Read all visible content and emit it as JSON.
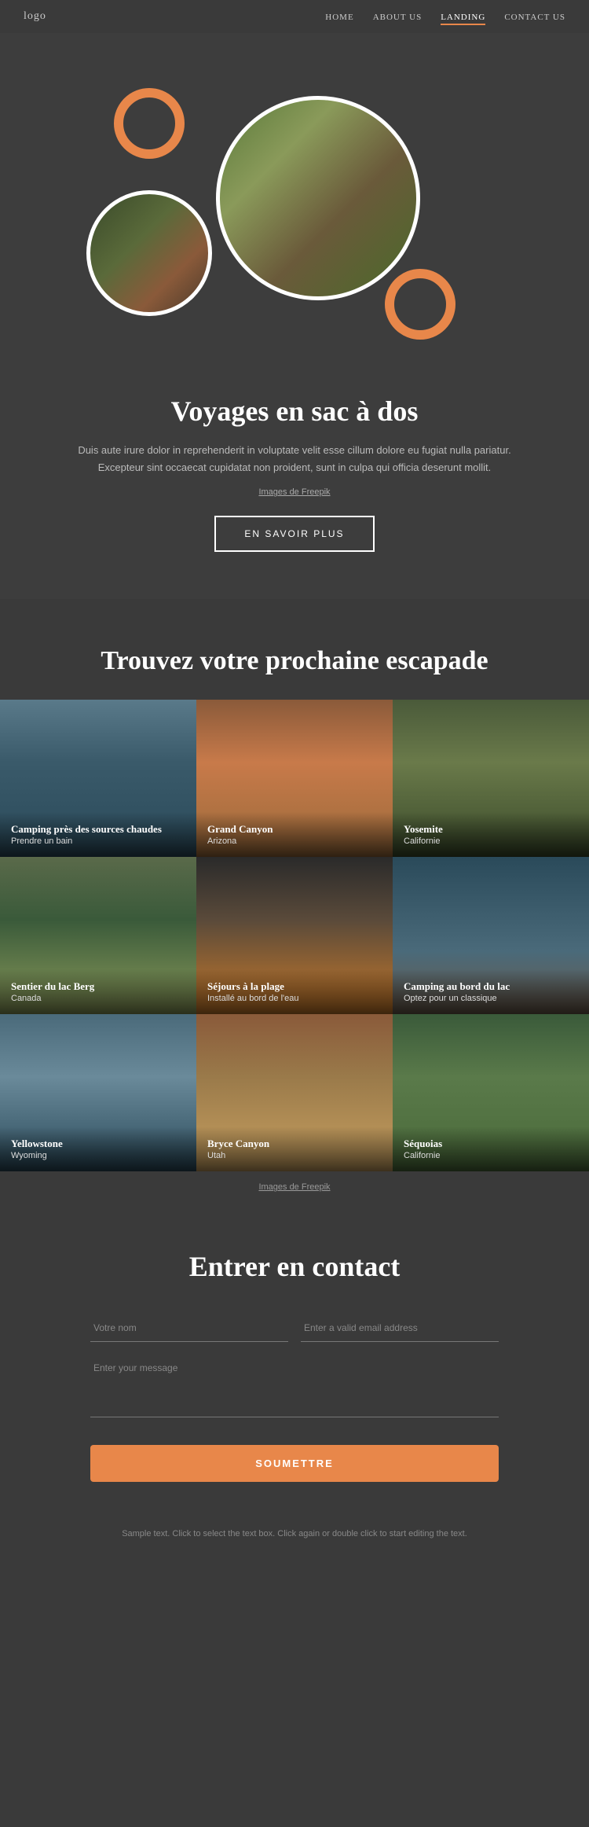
{
  "header": {
    "logo": "logo",
    "nav": [
      {
        "label": "HOME",
        "active": false
      },
      {
        "label": "ABOUT US",
        "active": false
      },
      {
        "label": "LANDING",
        "active": true
      },
      {
        "label": "CONTACT US",
        "active": false
      }
    ]
  },
  "hero": {
    "title": "Voyages en sac à dos",
    "description": "Duis aute irure dolor in reprehenderit in voluptate velit esse cillum dolore eu fugiat nulla pariatur. Excepteur sint occaecat cupidatat non proident, sunt in culpa qui officia deserunt mollit.",
    "attribution": "Images de Freepik",
    "button_label": "EN SAVOIR PLUS"
  },
  "gallery": {
    "title": "Trouvez votre prochaine escapade",
    "attribution": "Images de Freepik",
    "items": [
      {
        "title": "Camping près des sources chaudes",
        "subtitle": "Prendre un bain"
      },
      {
        "title": "Grand Canyon",
        "subtitle": "Arizona"
      },
      {
        "title": "Yosemite",
        "subtitle": "Californie"
      },
      {
        "title": "Sentier du lac Berg",
        "subtitle": "Canada"
      },
      {
        "title": "Séjours à la plage",
        "subtitle": "Installé au bord de l'eau"
      },
      {
        "title": "Camping au bord du lac",
        "subtitle": "Optez pour un classique"
      },
      {
        "title": "Yellowstone",
        "subtitle": "Wyoming"
      },
      {
        "title": "Bryce Canyon",
        "subtitle": "Utah"
      },
      {
        "title": "Séquoias",
        "subtitle": "Californie"
      }
    ]
  },
  "contact": {
    "title": "Entrer en contact",
    "name_placeholder": "Votre nom",
    "email_placeholder": "Enter a valid email address",
    "message_placeholder": "Enter your message",
    "submit_label": "SOUMETTRE"
  },
  "footer": {
    "note": "Sample text. Click to select the text box. Click again or double click to start editing the text."
  }
}
